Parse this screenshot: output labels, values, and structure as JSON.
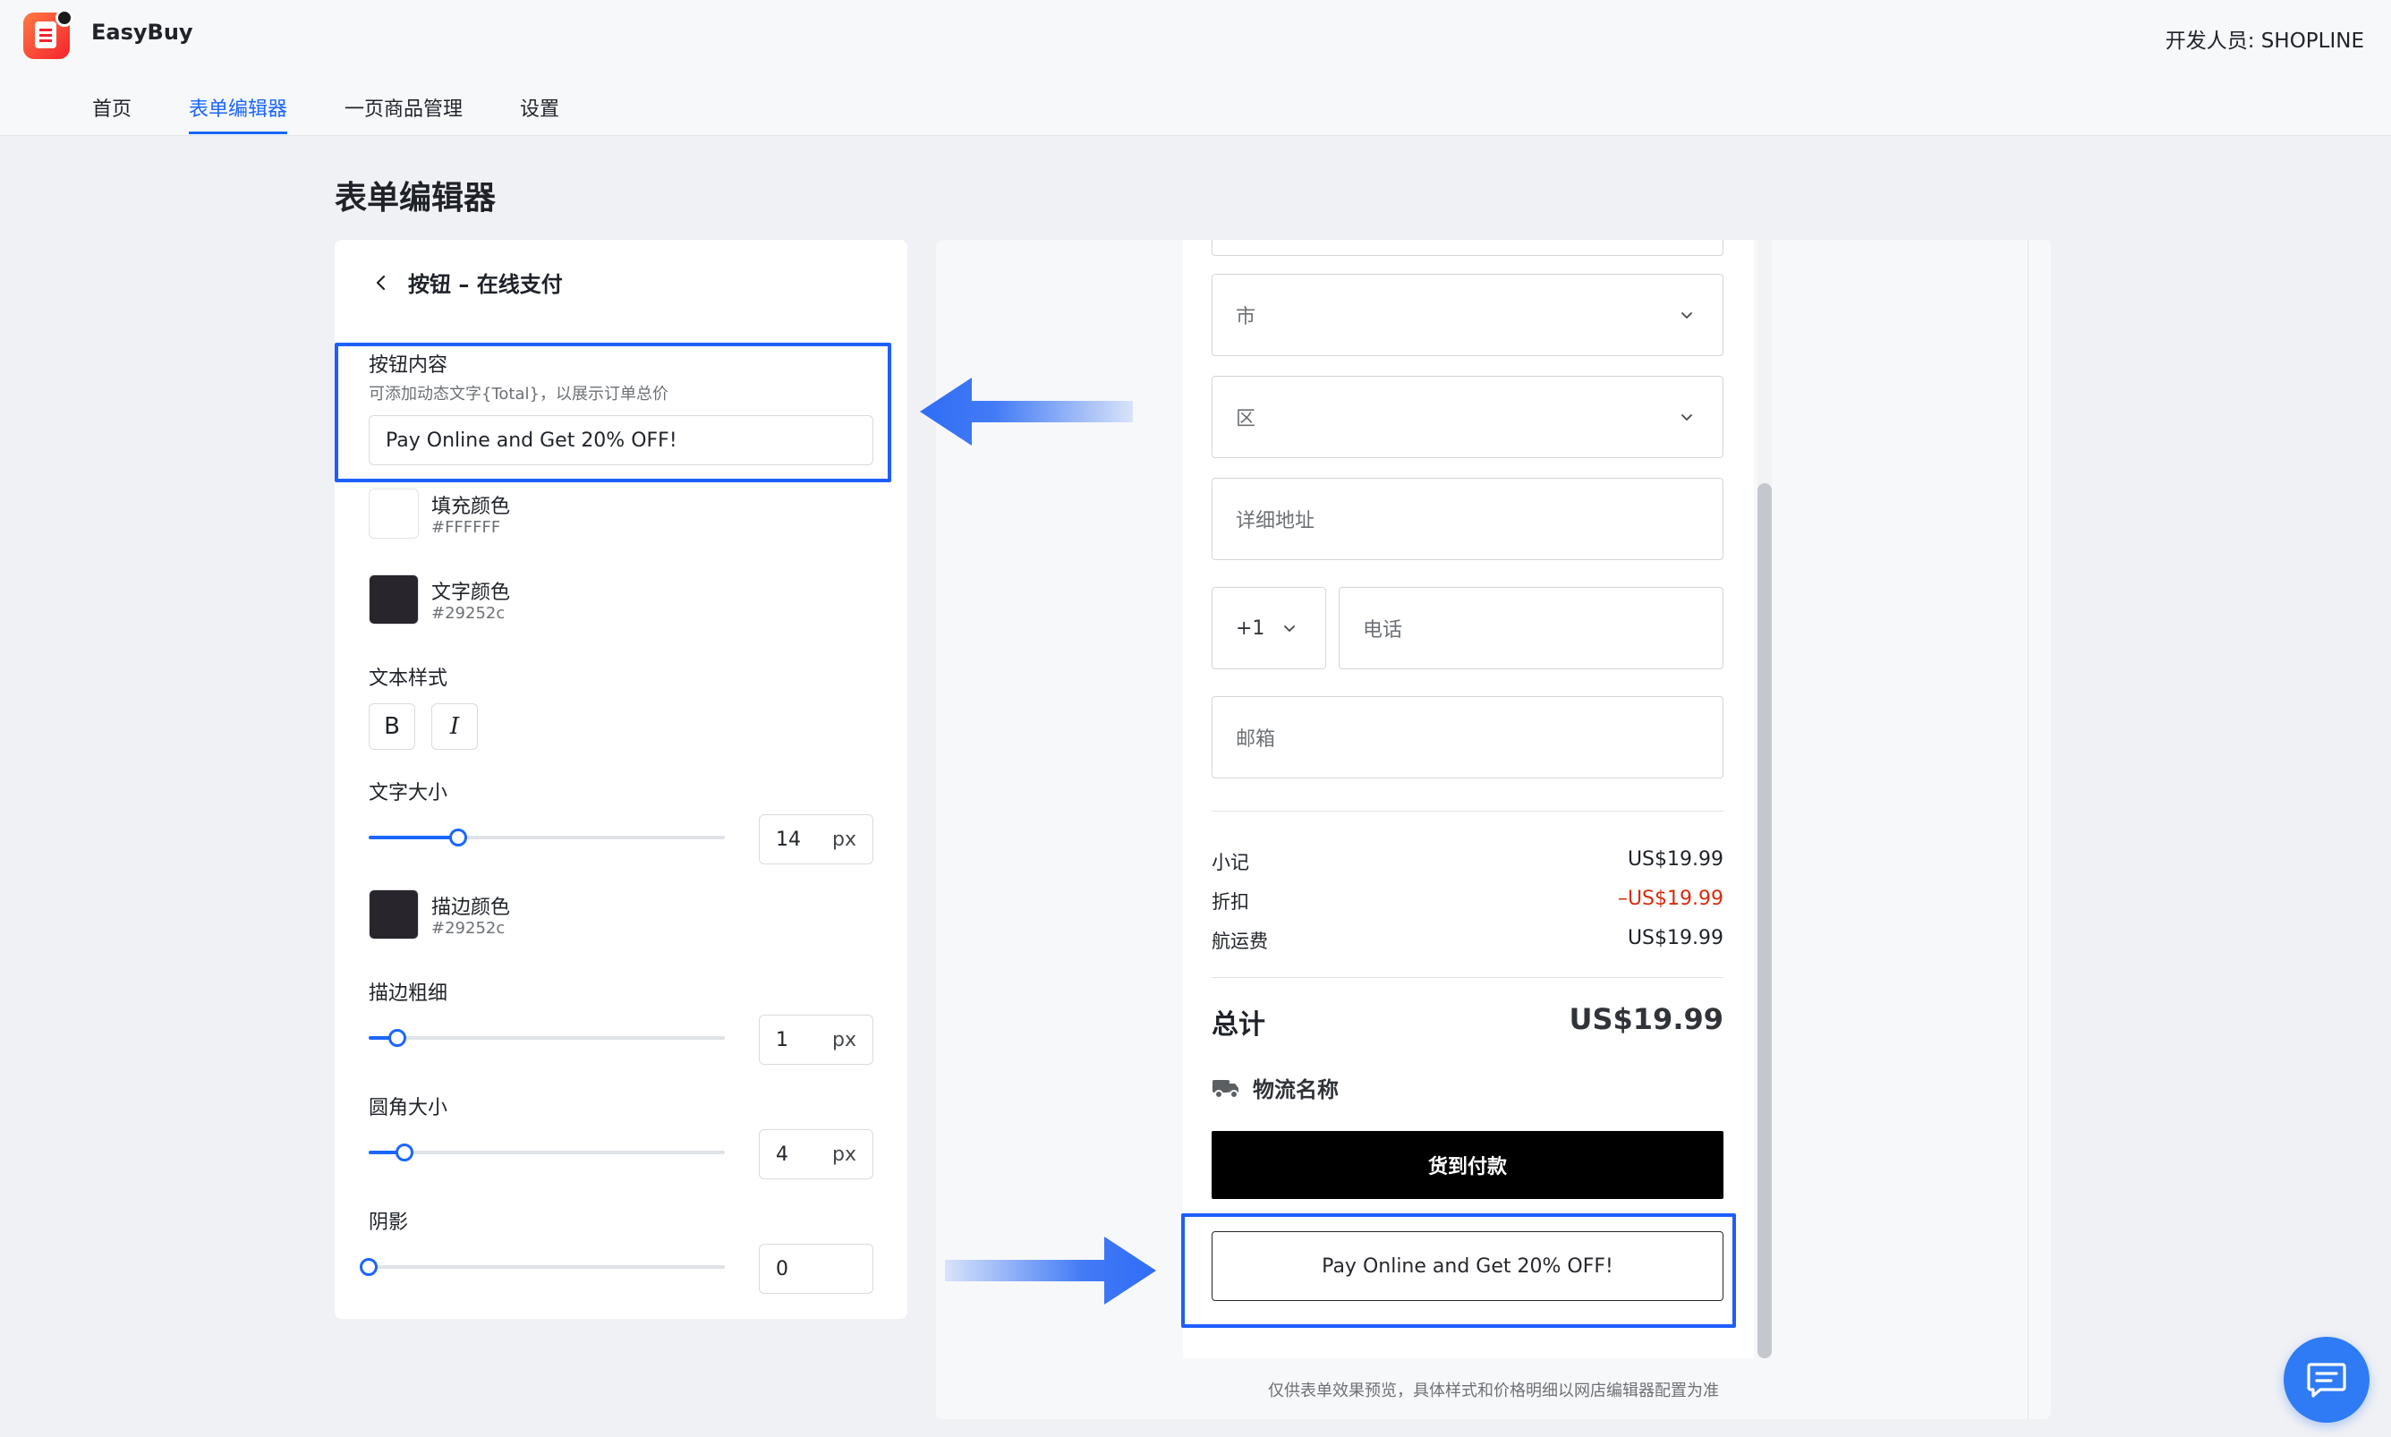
{
  "app": {
    "name": "EasyBuy",
    "developer": "开发人员: SHOPLINE"
  },
  "nav": {
    "tabs": [
      {
        "label": "首页",
        "active": false
      },
      {
        "label": "表单编辑器",
        "active": true
      },
      {
        "label": "一页商品管理",
        "active": false
      },
      {
        "label": "设置",
        "active": false
      }
    ]
  },
  "page": {
    "title": "表单编辑器"
  },
  "editor": {
    "panel_title": "按钮 – 在线支付",
    "button_content": {
      "label": "按钮内容",
      "help": "可添加动态文字{Total}，以展示订单总价",
      "value": "Pay Online and Get 20% OFF!"
    },
    "fill_color": {
      "label": "填充颜色",
      "hex": "#FFFFFF",
      "color": "#FFFFFF"
    },
    "text_color": {
      "label": "文字颜色",
      "hex": "#29252c",
      "color": "#29252c"
    },
    "text_style": {
      "label": "文本样式",
      "bold": "B",
      "italic": "I"
    },
    "font_size": {
      "label": "文字大小",
      "value": "14",
      "unit": "px",
      "level": 0.25
    },
    "border_color": {
      "label": "描边颜色",
      "hex": "#29252c",
      "color": "#29252c"
    },
    "border_width": {
      "label": "描边粗细",
      "value": "1",
      "unit": "px",
      "level": 0.08
    },
    "corner_radius": {
      "label": "圆角大小",
      "value": "4",
      "unit": "px",
      "level": 0.1
    },
    "shadow": {
      "label": "阴影",
      "value": "0",
      "level": 0
    }
  },
  "preview": {
    "fields": {
      "city": "市",
      "district": "区",
      "address": "详细地址",
      "phone_code": "+1",
      "phone": "电话",
      "email": "邮箱"
    },
    "summary": {
      "subtotal_label": "小记",
      "subtotal_value": "US$19.99",
      "discount_label": "折扣",
      "discount_value": "–US$19.99",
      "shipping_label": "航运费",
      "shipping_value": "US$19.99",
      "total_label": "总计",
      "total_value": "US$19.99"
    },
    "shipping_method": "物流名称",
    "cod_button": "货到付款",
    "pay_online_button": "Pay Online and Get 20% OFF!",
    "footnote": "仅供表单效果预览，具体样式和价格明细以网店编辑器配置为准",
    "discount_color": "#d72c0d"
  },
  "colors": {
    "accent": "#1a66ff",
    "highlight": "#1e5eff"
  },
  "icons": {
    "back": "chevron-left-icon",
    "dropdown": "chevron-down-icon",
    "truck": "truck-icon",
    "chat": "chat-icon",
    "arrow": "arrow-icon"
  }
}
